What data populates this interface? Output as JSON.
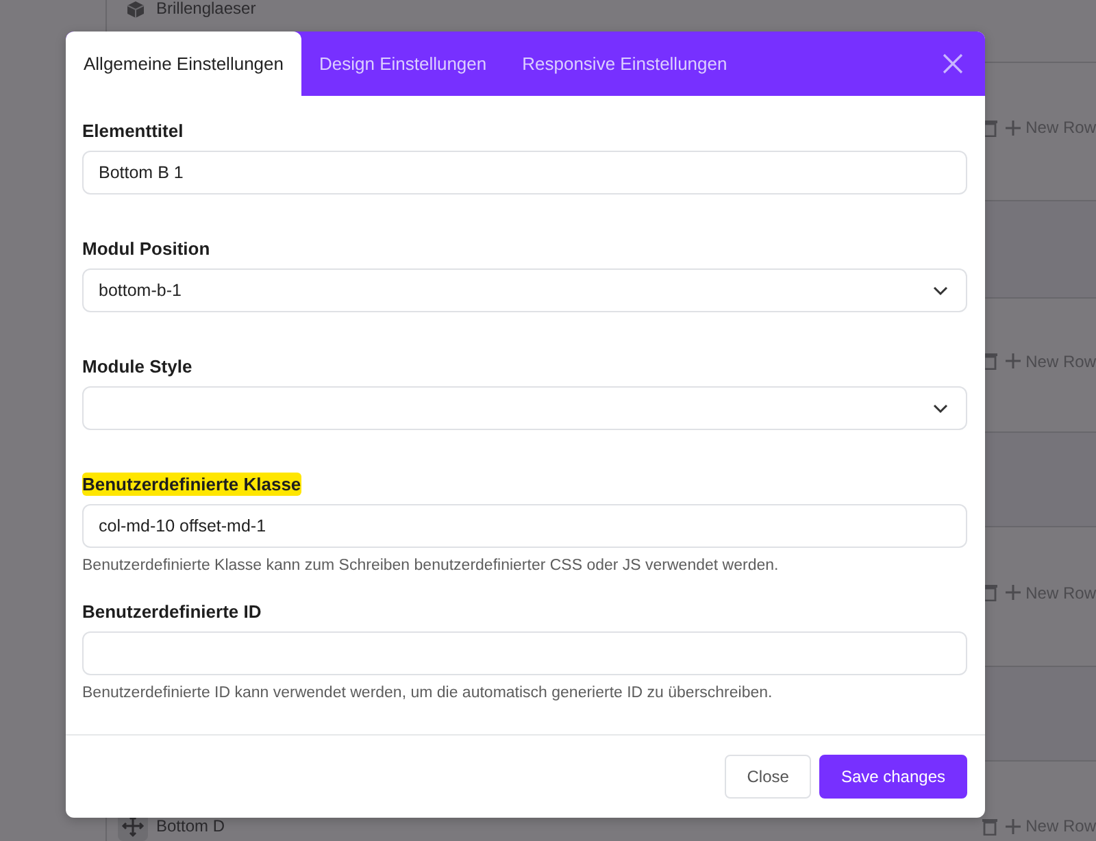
{
  "background": {
    "top_item": {
      "label": "Brillenglaeser"
    },
    "row_actions": [
      {
        "label": "New Row"
      },
      {
        "label": "New Row"
      },
      {
        "label": "New Row"
      },
      {
        "label": "New Row"
      }
    ],
    "bottom_row": {
      "label": "Bottom D"
    }
  },
  "modal": {
    "tabs": [
      {
        "label": "Allgemeine Einstellungen",
        "selected": true
      },
      {
        "label": "Design Einstellungen",
        "selected": false
      },
      {
        "label": "Responsive Einstellungen",
        "selected": false
      }
    ],
    "fields": [
      {
        "kind": "text",
        "label": "Elementtitel",
        "highlighted": false,
        "value": "Bottom B 1"
      },
      {
        "kind": "select",
        "label": "Modul Position",
        "highlighted": false,
        "value": "bottom-b-1"
      },
      {
        "kind": "select",
        "label": "Module Style",
        "highlighted": false
      },
      {
        "kind": "text",
        "label": "Benutzerdefinierte Klasse",
        "highlighted": true,
        "value": "col-md-10 offset-md-1",
        "help": "Benutzerdefinierte Klasse kann zum Schreiben benutzerdefinierter CSS oder JS verwendet werden."
      },
      {
        "kind": "text",
        "label": "Benutzerdefinierte ID",
        "highlighted": false,
        "help": "Benutzerdefinierte ID kann verwendet werden, um die automatisch generierte ID zu überschreiben."
      }
    ],
    "buttons": [
      {
        "label": "Close",
        "kind": "secondary"
      },
      {
        "label": "Save changes",
        "kind": "primary"
      }
    ]
  }
}
